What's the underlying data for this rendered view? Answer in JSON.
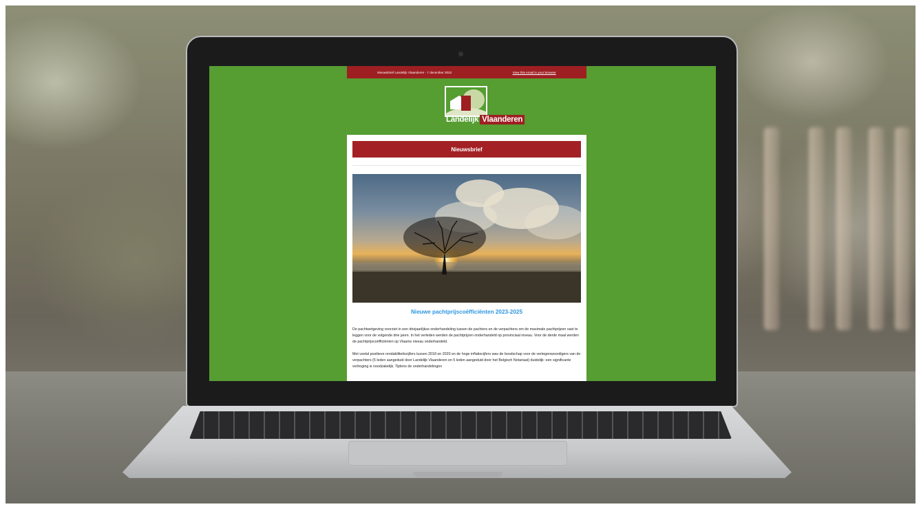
{
  "email": {
    "topbar": {
      "date_text": "Nieuwsbrief Landelijk Vlaanderen - 7 december 2022",
      "browser_link": "View this email in your browser"
    },
    "logo": {
      "word1": "Landelijk",
      "word2": "Vlaanderen"
    },
    "header": {
      "title": "Nieuwsbrief"
    },
    "hero_image": {
      "description_icon": "tree-at-sunrise-photo"
    },
    "article": {
      "title": "Nieuwe pachtprijscoëfficiënten 2023-2025",
      "paragraph1": "De pachtwetgeving voorziet in een driejaarlijkse onderhandeling tussen de pachters en de verpachters om de maximale pachtprijzen vast te leggen voor de volgende drie jaren. In het verleden werden de pachtprijzen onderhandeld op provinciaal niveau. Voor de derde maal werden de pachtprijscoëfficiënten op Vlaams niveau onderhandeld.",
      "paragraph2": "Met veelal positieve rendabiliteitscijfers tussen 2018 en 2020 en de hoge inflatiecijfers was de boodschap voor de vertegenwoordigers van de verpachters (5 leden aangeduid door Landelijk Vlaanderen en 5 leden aangeduid door het Belgisch Notariaat) duidelijk: een significante verhoging is noodzakelijk. Tijdens de onderhandelingen"
    },
    "colors": {
      "background_green": "#569d32",
      "brand_red": "#9e1f22",
      "title_blue": "#2d95e0"
    }
  }
}
